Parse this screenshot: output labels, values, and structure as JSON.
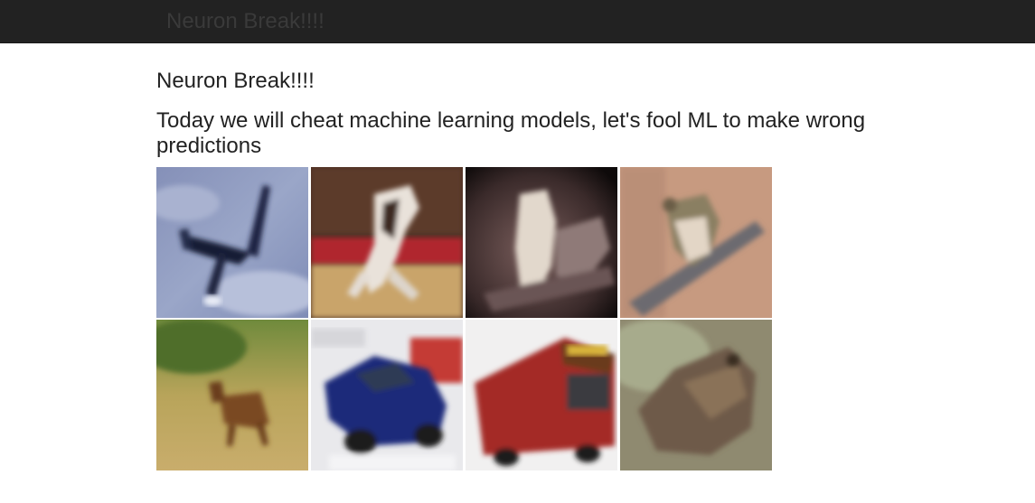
{
  "navbar": {
    "brand": "Neuron Break!!!!"
  },
  "main": {
    "title": "Neuron Break!!!!",
    "subtitle": "Today we will cheat machine learning models, let's fool ML to make wrong predictions"
  },
  "images": [
    {
      "subject": "airplane"
    },
    {
      "subject": "horse"
    },
    {
      "subject": "bird"
    },
    {
      "subject": "bird"
    },
    {
      "subject": "deer"
    },
    {
      "subject": "car"
    },
    {
      "subject": "truck"
    },
    {
      "subject": "frog"
    }
  ]
}
